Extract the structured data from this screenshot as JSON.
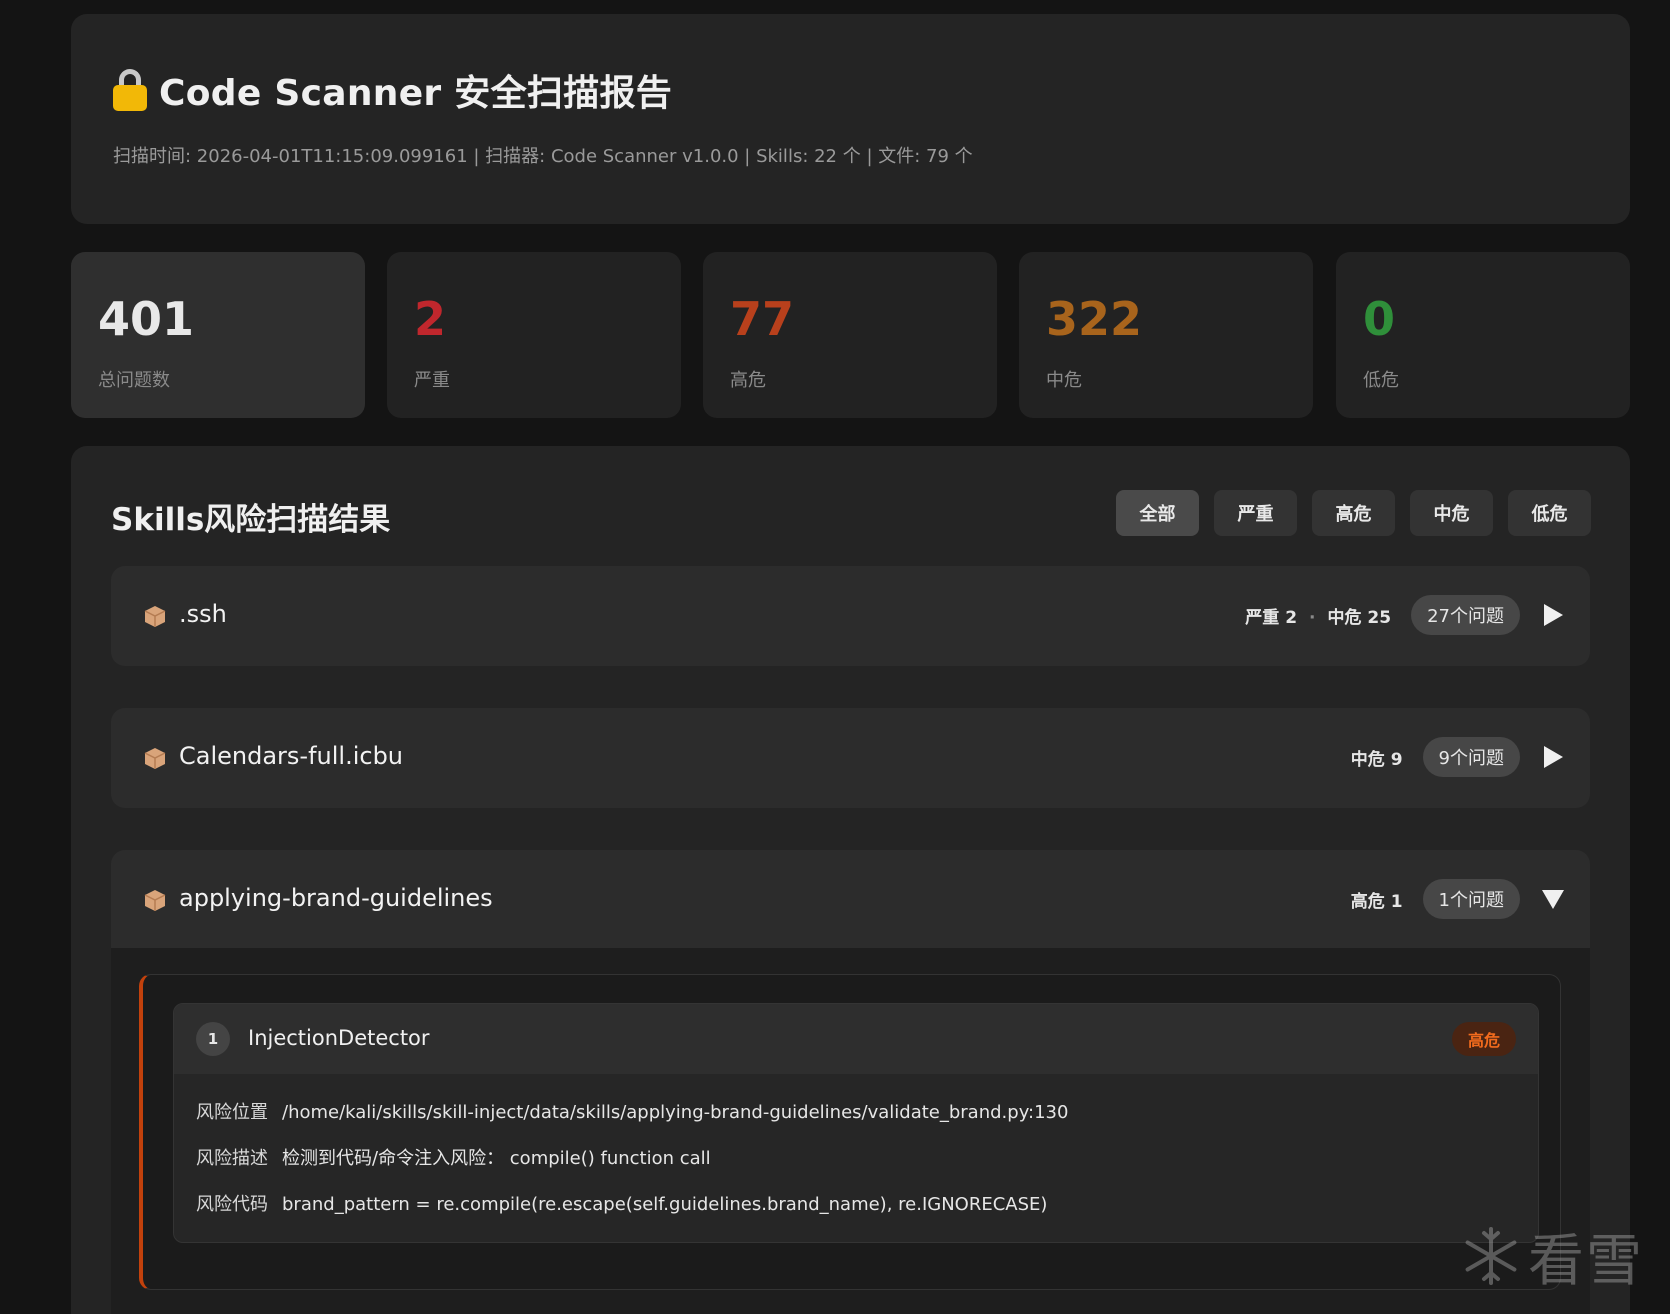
{
  "header": {
    "title": "Code Scanner 安全扫描报告",
    "meta": "扫描时间: 2026-04-01T11:15:09.099161 | 扫描器: Code Scanner v1.0.0 | Skills: 22 个 | 文件: 79 个"
  },
  "stats": [
    {
      "value": "401",
      "label": "总问题数",
      "color": "#e8e8e8"
    },
    {
      "value": "2",
      "label": "严重",
      "color": "#c0272d"
    },
    {
      "value": "77",
      "label": "高危",
      "color": "#b8401c"
    },
    {
      "value": "322",
      "label": "中危",
      "color": "#a8641c"
    },
    {
      "value": "0",
      "label": "低危",
      "color": "#2f8f3a"
    }
  ],
  "results": {
    "title": "Skills风险扫描结果",
    "filters": [
      "全部",
      "严重",
      "高危",
      "中危",
      "低危"
    ],
    "active_filter": "全部",
    "skills": [
      {
        "name": ".ssh",
        "sev1": "严重 2",
        "sev2": "中危 25",
        "count": "27个问题",
        "expanded": false
      },
      {
        "name": "Calendars-full.icbu",
        "sev1": "中危 9",
        "count": "9个问题",
        "expanded": false
      },
      {
        "name": "applying-brand-guidelines",
        "sev1": "高危 1",
        "count": "1个问题",
        "expanded": true
      }
    ],
    "issue": {
      "number": "1",
      "detector": "InjectionDetector",
      "severity": "高危",
      "location_label": "风险位置",
      "location": "/home/kali/skills/skill-inject/data/skills/applying-brand-guidelines/validate_brand.py:130",
      "description_label": "风险描述",
      "description": "检测到代码/命令注入风险： compile() function call",
      "code_label": "风险代码",
      "code": "brand_pattern = re.compile(re.escape(self.guidelines.brand_name), re.IGNORECASE)"
    }
  },
  "watermark": {
    "text": "看雪",
    "icon": "snowflake-icon"
  }
}
